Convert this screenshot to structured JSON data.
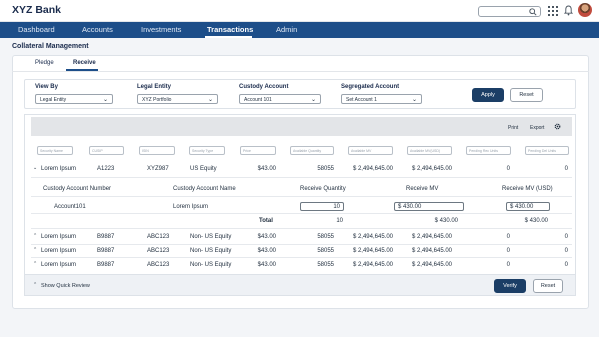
{
  "app": {
    "brand": "XYZ Bank"
  },
  "nav": {
    "tabs": [
      "Dashboard",
      "Accounts",
      "Investments",
      "Transactions",
      "Admin"
    ],
    "active": "Transactions"
  },
  "page": {
    "title": "Collateral Management"
  },
  "subtabs": [
    "Pledge",
    "Receive"
  ],
  "filters": {
    "view_by": {
      "label": "View By",
      "value": "Legal Entity"
    },
    "legal_entity": {
      "label": "Legal Entity",
      "value": "XYZ Portfolio"
    },
    "custody_account": {
      "label": "Custody Account",
      "value": "Account 101"
    },
    "segregated_account": {
      "label": "Segregated Account",
      "value": "Set Account 1"
    },
    "apply": "Apply",
    "reset": "Reset"
  },
  "toolbar": {
    "print": "Print",
    "export": "Export",
    "settings_icon": "gear-icon"
  },
  "column_filters": [
    "Security Name",
    "CUSIP",
    "ISIN",
    "Security Type",
    "Price",
    "Available Quantity",
    "Available MV",
    "Available MV(USD)",
    "Pending Rec Units",
    "Pending Del Units"
  ],
  "rows": [
    {
      "name": "Lorem Ipsum",
      "cusip": "A1223",
      "isin": "XYZ987",
      "type": "US Equity",
      "price": "$43.00",
      "qty": "58055",
      "mv": "$ 2,494,645.00",
      "mv_usd": "$ 2,494,645.00",
      "pend_rec": "0",
      "pend_del": "0"
    },
    {
      "name": "Lorem Ipsum",
      "cusip": "B9887",
      "isin": "ABC123",
      "type": "Non- US Equity",
      "price": "$43.00",
      "qty": "58055",
      "mv": "$ 2,494,645.00",
      "mv_usd": "$ 2,494,645.00",
      "pend_rec": "0",
      "pend_del": "0"
    },
    {
      "name": "Lorem Ipsum",
      "cusip": "B9887",
      "isin": "ABC123",
      "type": "Non- US Equity",
      "price": "$43.00",
      "qty": "58055",
      "mv": "$ 2,494,645.00",
      "mv_usd": "$ 2,494,645.00",
      "pend_rec": "0",
      "pend_del": "0"
    },
    {
      "name": "Lorem Ipsum",
      "cusip": "B9887",
      "isin": "ABC123",
      "type": "Non- US Equity",
      "price": "$43.00",
      "qty": "58055",
      "mv": "$ 2,494,645.00",
      "mv_usd": "$ 2,494,645.00",
      "pend_rec": "0",
      "pend_del": "0"
    }
  ],
  "detail": {
    "headers": [
      "Custody Account Number",
      "Custody Account Name",
      "Receive Quantity",
      "Receive MV",
      "Receive MV (USD)"
    ],
    "row": {
      "number": "Account101",
      "name": "Lorem Ipsum",
      "qty": "10",
      "mv": "$ 430.00",
      "mv_usd": "$ 430.00"
    },
    "total": {
      "label": "Total",
      "qty": "10",
      "mv": "$ 430.00",
      "mv_usd": "$ 430.00"
    }
  },
  "footer": {
    "quick_review": "Show Quick Review",
    "verify": "Verify",
    "reset": "Reset"
  }
}
